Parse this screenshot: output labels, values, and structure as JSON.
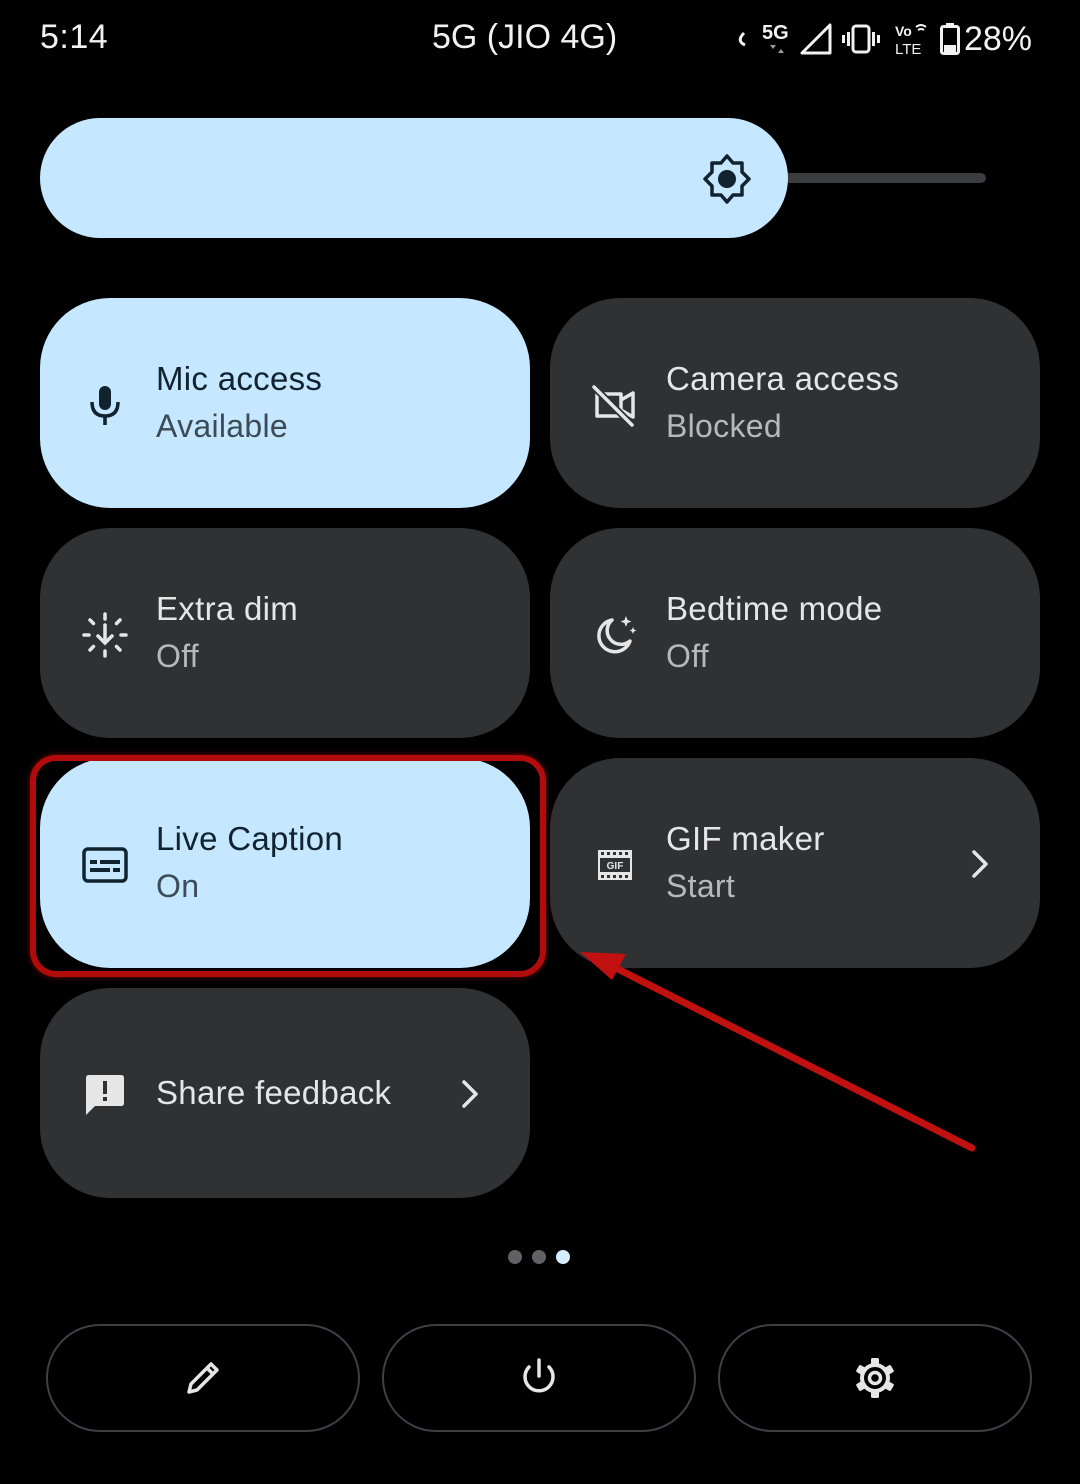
{
  "status_bar": {
    "time": "5:14",
    "carrier": "5G (JIO 4G)",
    "network_badge": "5G",
    "volte_badge_top": "Vo",
    "volte_badge_bottom": "LTE",
    "battery": "28%",
    "icons": [
      "5g-icon",
      "signal-icon",
      "vibrate-icon",
      "volte-icon",
      "battery-icon"
    ]
  },
  "brightness": {
    "level_percent": 76,
    "icon": "brightness-icon"
  },
  "tiles": [
    {
      "id": "mic",
      "title": "Mic access",
      "subtitle": "Available",
      "state": "on",
      "icon": "mic-icon"
    },
    {
      "id": "camera",
      "title": "Camera access",
      "subtitle": "Blocked",
      "state": "off",
      "icon": "camera-off-icon"
    },
    {
      "id": "extra_dim",
      "title": "Extra dim",
      "subtitle": "Off",
      "state": "off",
      "icon": "extra-dim-icon"
    },
    {
      "id": "bedtime",
      "title": "Bedtime mode",
      "subtitle": "Off",
      "state": "off",
      "icon": "bedtime-icon"
    },
    {
      "id": "live_caption",
      "title": "Live Caption",
      "subtitle": "On",
      "state": "on",
      "icon": "caption-icon"
    },
    {
      "id": "gif_maker",
      "title": "GIF maker",
      "subtitle": "Start",
      "state": "off",
      "icon": "gif-icon"
    },
    {
      "id": "share_feedback",
      "title": "Share feedback",
      "state": "off",
      "icon": "feedback-icon"
    }
  ],
  "gif_icon_text": "GIF",
  "page_indicator": {
    "count": 3,
    "active_index": 2
  },
  "bottom_actions": [
    {
      "id": "edit",
      "icon": "pencil-icon"
    },
    {
      "id": "power",
      "icon": "power-icon"
    },
    {
      "id": "settings",
      "icon": "gear-icon"
    }
  ],
  "colors": {
    "background": "#000000",
    "tile_on": "#c5e7ff",
    "tile_off": "#2f3133",
    "annotation_red": "#b20b0b"
  }
}
